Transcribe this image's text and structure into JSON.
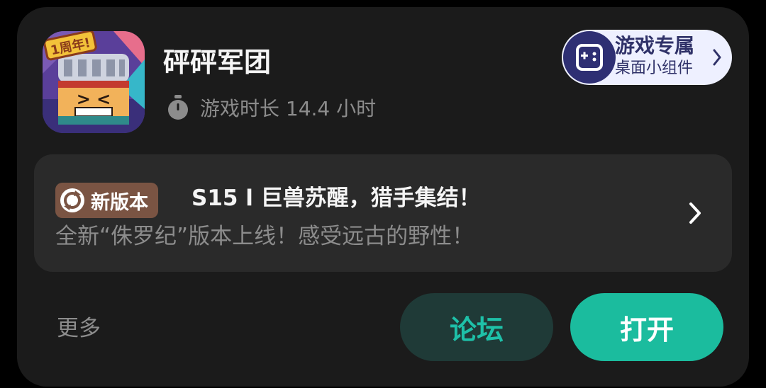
{
  "app": {
    "name": "砰砰军团",
    "icon_name": "app-icon-pengpeng-legion",
    "icon_badge": "1周年!",
    "playtime": "游戏时长 14.4 小时"
  },
  "widget": {
    "title": "游戏专属",
    "subtitle": "桌面小组件"
  },
  "news": {
    "badge": "新版本",
    "title": "S15 l 巨兽苏醒，猎手集结！",
    "subtitle": "全新“侏罗纪”版本上线！感受远古的野性！"
  },
  "footer": {
    "more": "更多",
    "forum": "论坛",
    "open": "打开"
  },
  "colors": {
    "card_bg": "#1b1b1b",
    "news_bg": "#2a2a2a",
    "accent": "#1bbc9e",
    "forum_bg": "#1f3a37",
    "badge_bg": "#7a5443",
    "widget_bg": "#eef0ff"
  }
}
